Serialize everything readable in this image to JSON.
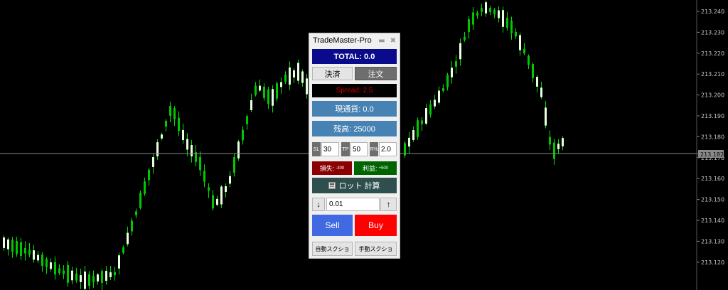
{
  "chart": {
    "current_price": "213.182",
    "price_axis": [
      "213.240",
      "213.230",
      "213.220",
      "213.210",
      "213.200",
      "213.190",
      "213.180",
      "213.170",
      "213.160",
      "213.150",
      "213.140",
      "213.130",
      "213.120"
    ],
    "colors": {
      "background": "#000000",
      "bull_body": "#e8ffe0",
      "bear_body": "#00c800",
      "wick": "#00e000",
      "axis_text": "#c8c8c8"
    }
  },
  "panel": {
    "title": "TradeMaster-Pro",
    "minimize_icon": "minimize-icon",
    "close_icon": "close-icon",
    "total": "TOTAL: 0.0",
    "tabs": {
      "close": "決済",
      "order": "注文"
    },
    "spread": "Spread: 2.5",
    "current_currency": "現通貨: 0.0",
    "balance": "残高: 25000",
    "params": {
      "sl_label": "SL",
      "sl_value": "30",
      "tp_label": "TP",
      "tp_value": "50",
      "risk_label": "R%",
      "risk_value": "2.0"
    },
    "loss": {
      "label": "損失:",
      "value": "-300"
    },
    "profit": {
      "label": "利益:",
      "value": "+500"
    },
    "lot_calc": {
      "label": "ロット 計算",
      "icon": "calculator-icon"
    },
    "lot": {
      "down": "↓",
      "value": "0.01",
      "up": "↑"
    },
    "sell": "Sell",
    "buy": "Buy",
    "auto_screenshot": "自動スクショ",
    "manual_screenshot": "手動スクショ",
    "colors": {
      "total_bg": "#0a0a8c",
      "spread_text": "#d00000",
      "info_bg": "#4682b4",
      "loss_bg": "#8b0000",
      "profit_bg": "#006400",
      "calc_bg": "#2f4f4f",
      "sell_bg": "#4169e1",
      "buy_bg": "#ff0000"
    }
  }
}
